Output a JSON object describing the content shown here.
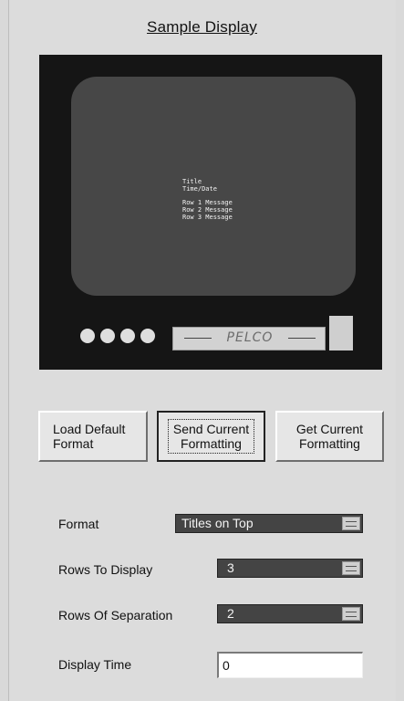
{
  "header": {
    "title": "Sample Display"
  },
  "monitor": {
    "screen_lines": [
      "Title",
      "Time/Date"
    ],
    "screen_rows": [
      "Row 1 Message",
      "Row 2 Message",
      "Row 3 Message"
    ],
    "brand": "PELCO"
  },
  "buttons": {
    "load_default": [
      "Load Default",
      "Format"
    ],
    "send_current": [
      "Send Current",
      "Formatting"
    ],
    "get_current": [
      "Get Current",
      "Formatting"
    ]
  },
  "form": {
    "format": {
      "label": "Format",
      "value": "Titles on Top"
    },
    "rows_to_display": {
      "label": "Rows To Display",
      "value": "3"
    },
    "rows_of_separation": {
      "label": "Rows Of Separation",
      "value": "2"
    },
    "display_time": {
      "label": "Display Time",
      "value": "0"
    }
  },
  "colors": {
    "monitor_bezel": "#151515",
    "screen": "#474747",
    "select_bg": "#444444"
  }
}
